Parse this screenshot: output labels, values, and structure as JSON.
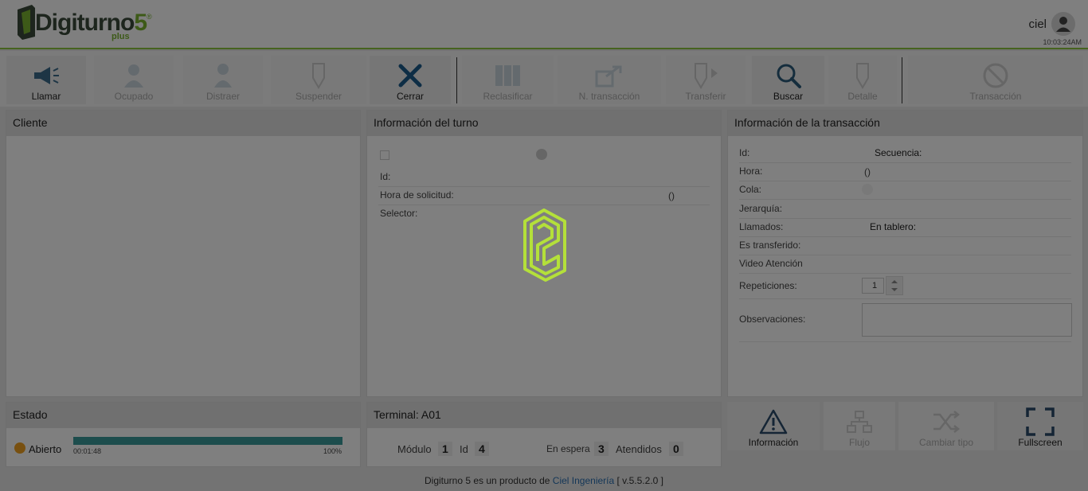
{
  "header": {
    "logo_text": "Digiturno",
    "logo_five": "5",
    "logo_sup": "®",
    "logo_plus": "plus",
    "user": "ciel",
    "clock": "10:03:24AM"
  },
  "toolbar": {
    "llamar": "Llamar",
    "ocupado": "Ocupado",
    "distraer": "Distraer",
    "suspender": "Suspender",
    "cerrar": "Cerrar",
    "reclasificar": "Reclasificar",
    "ntransaccion": "N. transacción",
    "transferir": "Transferir",
    "buscar": "Buscar",
    "detalle": "Detalle",
    "transaccion": "Transacción"
  },
  "cliente": {
    "title": "Cliente"
  },
  "turno": {
    "title": "Información del turno",
    "id_label": "Id:",
    "hora_label": "Hora de solicitud:",
    "hora_value": "()",
    "selector_label": "Selector:"
  },
  "transaccion": {
    "title": "Información de la transacción",
    "id_label": "Id:",
    "secuencia_label": "Secuencia:",
    "hora_label": "Hora:",
    "hora_value": "()",
    "cola_label": "Cola:",
    "jerarquia_label": "Jerarquía:",
    "llamados_label": "Llamados:",
    "tablero_label": "En tablero:",
    "transferido_label": "Es transferido:",
    "video_label": "Video Atención",
    "repeticiones_label": "Repeticiones:",
    "repeticiones_value": "1",
    "observaciones_label": "Observaciones:"
  },
  "estado": {
    "title": "Estado",
    "status": "Abierto",
    "timer": "00:01:48",
    "percent": "100%",
    "progress": 1.0
  },
  "terminal": {
    "title": "Terminal: A01",
    "modulo_label": "Módulo",
    "modulo_value": "1",
    "id_label": "Id",
    "id_value": "4",
    "espera_label": "En espera",
    "espera_value": "3",
    "atendidos_label": "Atendidos",
    "atendidos_value": "0"
  },
  "actions": {
    "informacion": "Información",
    "flujo": "Flujo",
    "cambiar_tipo": "Cambiar tipo",
    "fullscreen": "Fullscreen"
  },
  "footer": {
    "prefix": "Digiturno 5 es un producto de",
    "link": "Ciel Ingeniería",
    "version": "[ v.5.5.2.0 ]"
  },
  "colors": {
    "brand_green": "#8dc63f",
    "progress": "#3a9a9a",
    "status_dot": "#f0a020",
    "cerrar": "#1a5a8a"
  }
}
